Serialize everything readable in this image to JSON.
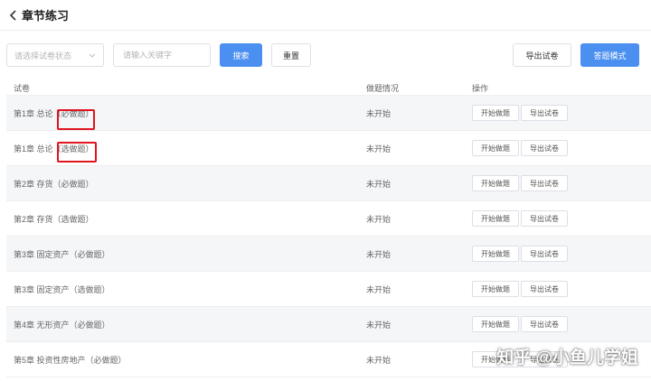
{
  "header": {
    "title": "章节练习",
    "back_icon": "chevron-left-icon"
  },
  "toolbar": {
    "status_select_placeholder": "请选择试卷状态",
    "keyword_placeholder": "请输入关键字",
    "search_label": "搜索",
    "reset_label": "重置",
    "export_all_label": "导出试卷",
    "answer_mode_label": "答题模式"
  },
  "table": {
    "columns": [
      "试卷",
      "做题情况",
      "操作"
    ],
    "rows": [
      {
        "name": "第1章 总论（必做题）",
        "status": "未开始",
        "start": "开始做题",
        "export": "导出试卷"
      },
      {
        "name": "第1章 总论（选做题）",
        "status": "未开始",
        "start": "开始做题",
        "export": "导出试卷"
      },
      {
        "name": "第2章 存货（必做题）",
        "status": "未开始",
        "start": "开始做题",
        "export": "导出试卷"
      },
      {
        "name": "第2章 存货（选做题）",
        "status": "未开始",
        "start": "开始做题",
        "export": "导出试卷"
      },
      {
        "name": "第3章 固定资产（必做题）",
        "status": "未开始",
        "start": "开始做题",
        "export": "导出试卷"
      },
      {
        "name": "第3章 固定资产（选做题）",
        "status": "未开始",
        "start": "开始做题",
        "export": "导出试卷"
      },
      {
        "name": "第4章 无形资产（必做题）",
        "status": "未开始",
        "start": "开始做题",
        "export": "导出试卷"
      },
      {
        "name": "第5章 投资性房地产（必做题）",
        "status": "未开始",
        "start": "开始做题",
        "export": "导出试卷"
      }
    ]
  },
  "watermark": {
    "text": "知乎 @小鱼儿学姐"
  },
  "colors": {
    "primary": "#4b8ff0",
    "highlight": "#e0141e",
    "row_alt": "#f5f6f8"
  }
}
